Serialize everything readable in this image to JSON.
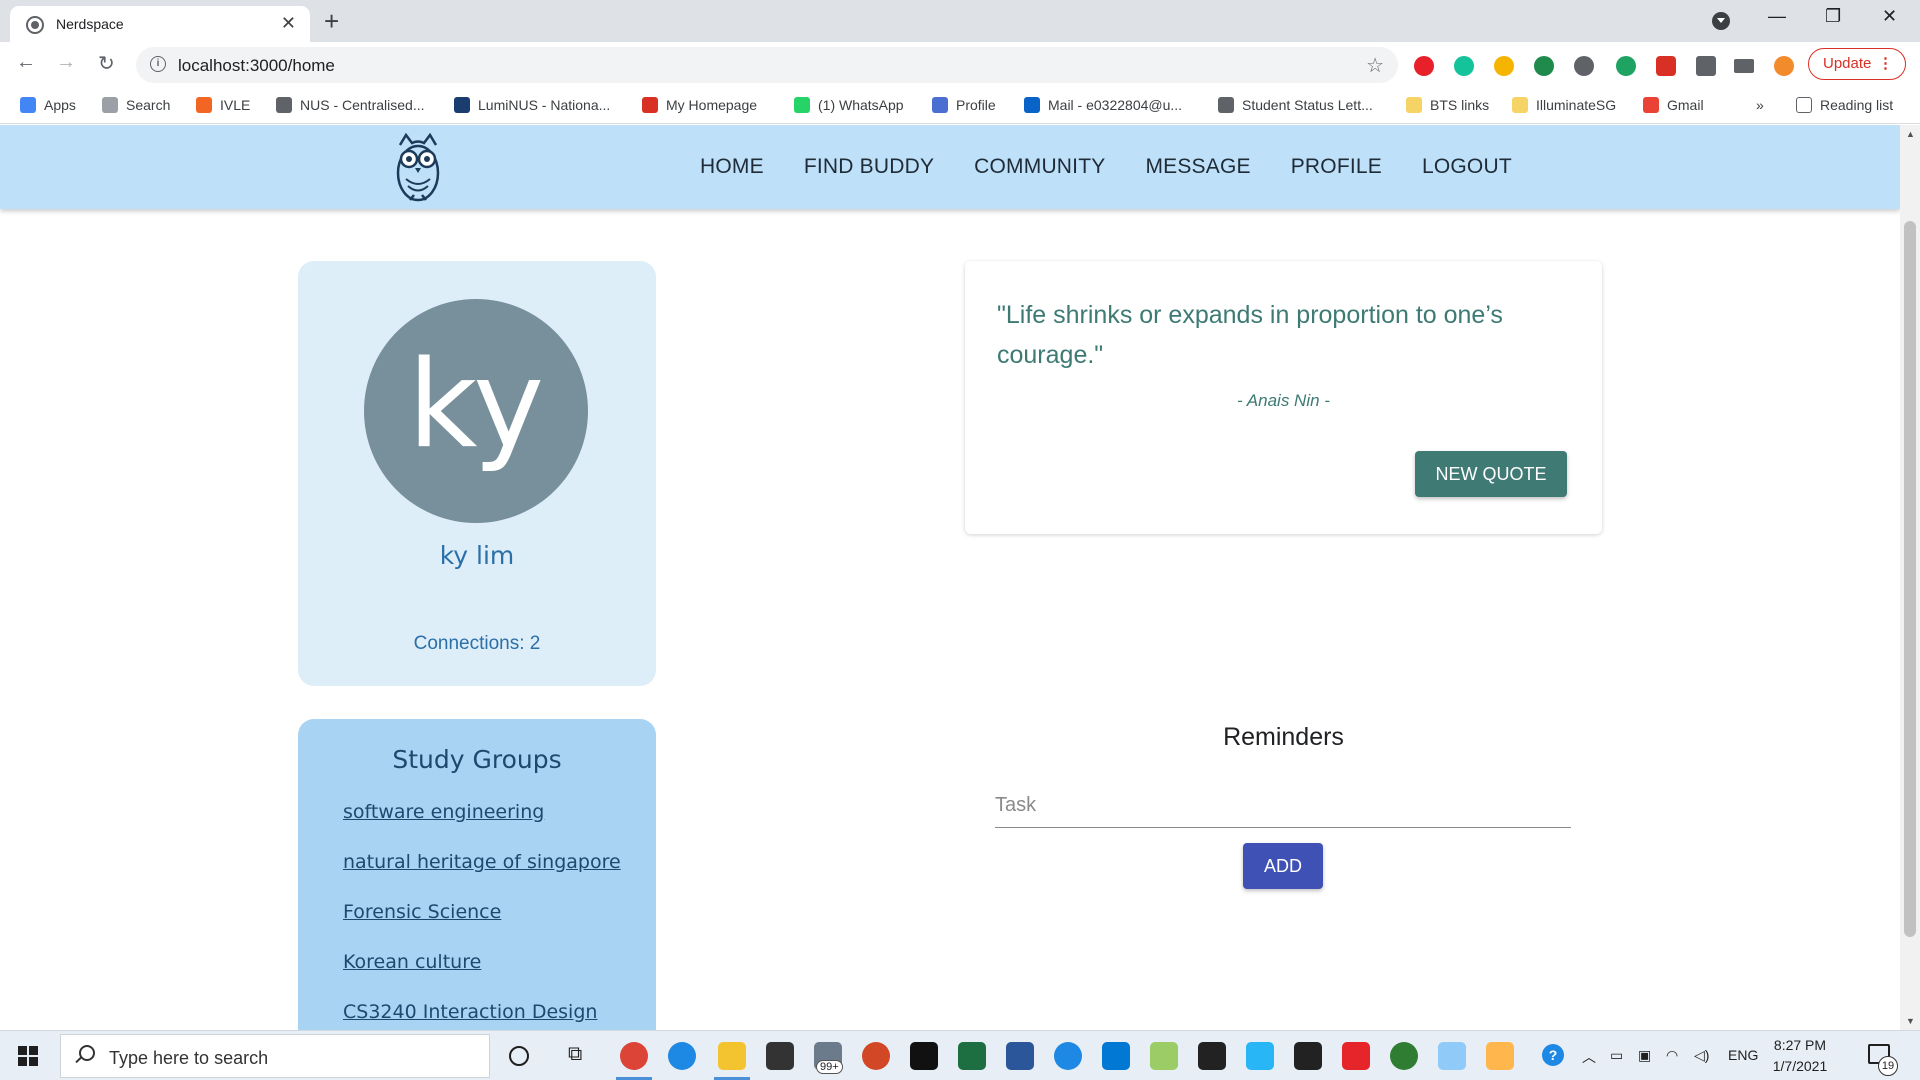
{
  "browser": {
    "tab_title": "Nerdspace",
    "url": "localhost:3000/home",
    "update_label": "Update"
  },
  "bookmarks": [
    {
      "label": "Apps",
      "color": "#4285f4"
    },
    {
      "label": "Search",
      "color": "#9aa0a6"
    },
    {
      "label": "IVLE",
      "color": "#f26522"
    },
    {
      "label": "NUS - Centralised...",
      "color": "#5f6368"
    },
    {
      "label": "LumiNUS - Nationa...",
      "color": "#1a3c6e"
    },
    {
      "label": "My Homepage",
      "color": "#d93025"
    },
    {
      "label": "(1) WhatsApp",
      "color": "#25d366"
    },
    {
      "label": "Profile",
      "color": "#4a6fd1"
    },
    {
      "label": "Mail - e0322804@u...",
      "color": "#0a64c8"
    },
    {
      "label": "Student Status Lett...",
      "color": "#5f6368"
    },
    {
      "label": "BTS links",
      "color": "#f6d365"
    },
    {
      "label": "IlluminateSG",
      "color": "#f6d365"
    },
    {
      "label": "Gmail",
      "color": "#ea4335"
    }
  ],
  "bookmarks_overflow": "»",
  "reading_list": "Reading list",
  "nav": {
    "items": [
      "HOME",
      "FIND BUDDY",
      "COMMUNITY",
      "MESSAGE",
      "PROFILE",
      "LOGOUT"
    ]
  },
  "profile": {
    "initials": "ky",
    "name": "ky lim",
    "connections": "Connections: 2"
  },
  "study_groups": {
    "title": "Study Groups",
    "items": [
      "software engineering",
      "natural heritage of singapore",
      "Forensic Science",
      "Korean culture",
      "CS3240 Interaction Design"
    ]
  },
  "quote": {
    "text": "\"Life shrinks or expands in proportion to one’s courage.\"",
    "author": "- Anais Nin -",
    "button": "NEW QUOTE"
  },
  "reminders": {
    "title": "Reminders",
    "task_placeholder": "Task",
    "task_value": "",
    "add_button": "ADD"
  },
  "taskbar": {
    "search_placeholder": "Type here to search",
    "time": "8:27 PM",
    "date": "1/7/2021",
    "language": "ENG",
    "notification_count": "19",
    "mail_badge": "99+"
  },
  "colors": {
    "appbar": "#bee0f8",
    "profile_card": "#ddeef9",
    "groups_card": "#a9d3f3",
    "quote_text": "#3d7a74",
    "new_quote_button": "#3f7a75",
    "add_button": "#3f51b5",
    "avatar": "#78909c"
  }
}
